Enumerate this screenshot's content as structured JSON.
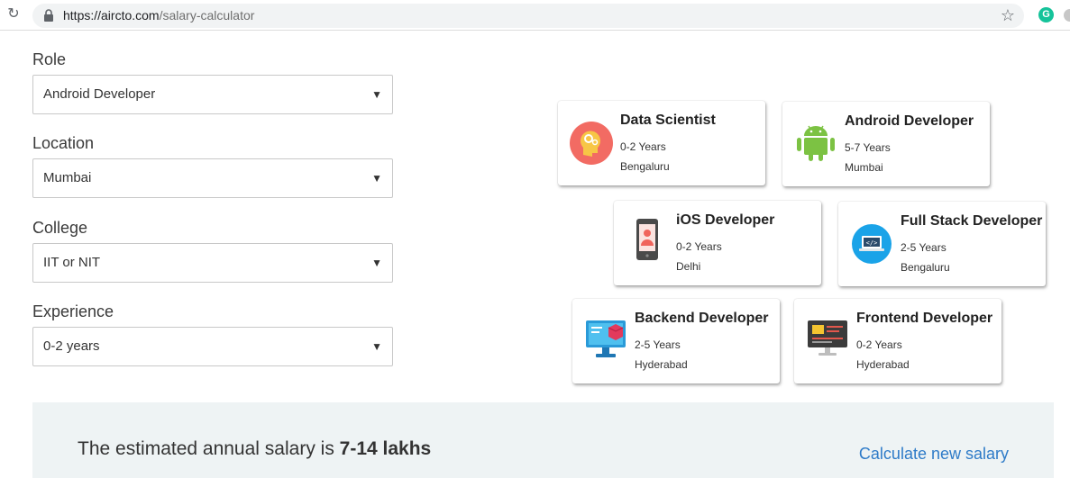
{
  "browser": {
    "url_host": "https://aircto.com",
    "url_path": "/salary-calculator",
    "grammarly_letter": "G"
  },
  "form": {
    "role": {
      "label": "Role",
      "value": "Android Developer"
    },
    "location": {
      "label": "Location",
      "value": "Mumbai"
    },
    "college": {
      "label": "College",
      "value": "IIT or NIT"
    },
    "experience": {
      "label": "Experience",
      "value": "0-2 years"
    },
    "caret": "▼"
  },
  "cards": [
    {
      "title": "Data Scientist",
      "experience": "0-2 Years",
      "city": "Bengaluru",
      "icon": "data-scientist-icon"
    },
    {
      "title": "Android Developer",
      "experience": "5-7 Years",
      "city": "Mumbai",
      "icon": "android-icon"
    },
    {
      "title": "iOS Developer",
      "experience": "0-2 Years",
      "city": "Delhi",
      "icon": "mobile-phone-icon"
    },
    {
      "title": "Full Stack Developer",
      "experience": "2-5 Years",
      "city": "Bengaluru",
      "icon": "code-laptop-icon"
    },
    {
      "title": "Backend Developer",
      "experience": "2-5 Years",
      "city": "Hyderabad",
      "icon": "server-monitor-icon"
    },
    {
      "title": "Frontend Developer",
      "experience": "0-2 Years",
      "city": "Hyderabad",
      "icon": "web-monitor-icon"
    }
  ],
  "result": {
    "prefix": "The estimated annual salary is ",
    "amount": "7-14 lakhs",
    "link": "Calculate new salary"
  }
}
